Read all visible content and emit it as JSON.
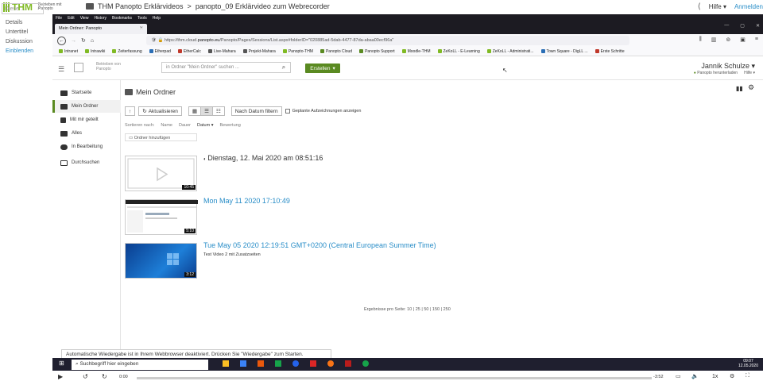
{
  "outer": {
    "logo": "THM",
    "logo_sub": "Betrieben mit Panopto",
    "breadcrumb_root": "THM Panopto Erklärvideos",
    "breadcrumb_sep": ">",
    "breadcrumb_current": "panopto_09 Erklärvideo zum Webrecorder",
    "help": "Hilfe",
    "login": "Anmelden",
    "search_placeholder": "Diese ...",
    "side_links": [
      "Details",
      "Untertitel",
      "Diskussion",
      "Einblenden"
    ]
  },
  "browser": {
    "menu": [
      "File",
      "Edit",
      "View",
      "History",
      "Bookmarks",
      "Tools",
      "Help"
    ],
    "tab_title": "Mein Ordner: Panopto",
    "url_prefix": "https://thm.cloud.",
    "url_domain": "panopto.eu",
    "url_rest": "/Panopto/Pages/Sessions/List.aspx#folderID=\"020885ad-5dab-4477-87da-abaa00ecf96a\"",
    "bookmarks": [
      {
        "label": "Intranet",
        "color": "#80ba24"
      },
      {
        "label": "Intrawiki",
        "color": "#80ba24"
      },
      {
        "label": "Zeiterfassung",
        "color": "#80ba24"
      },
      {
        "label": "Etherpad",
        "color": "#2a6eb5"
      },
      {
        "label": "EtherCalc",
        "color": "#c0392b"
      },
      {
        "label": "Live-Mahara",
        "color": "#555"
      },
      {
        "label": "Projekt-Mahara",
        "color": "#555"
      },
      {
        "label": "Panopto-THM",
        "color": "#80ba24"
      },
      {
        "label": "Panopto Cloud",
        "color": "#5a8a21"
      },
      {
        "label": "Panopto Support",
        "color": "#5a8a21"
      },
      {
        "label": "Moodle-THM",
        "color": "#80ba24"
      },
      {
        "label": "ZeKoLL - E-Learning",
        "color": "#80ba24"
      },
      {
        "label": "ZeKoLL - Administrati...",
        "color": "#80ba24"
      },
      {
        "label": "Town Square - DigLL ...",
        "color": "#2a6eb5"
      },
      {
        "label": "Erste Schritte",
        "color": "#c0392b"
      }
    ]
  },
  "panopto": {
    "logo_text": "Betrieben von Panopto",
    "search_placeholder": "in Ordner \"Mein Ordner\" suchen ...",
    "create": "Erstellen",
    "user_name": "Jannik Schulze",
    "download": "Panopto herunterladen",
    "help": "Hilfe",
    "nav": [
      "Startseite",
      "Mein Ordner",
      "Mit mir geteilt",
      "Alles",
      "In Bearbeitung",
      "Durchsuchen"
    ],
    "folder_title": "Mein Ordner",
    "refresh": "Aktualisieren",
    "filter_date": "Nach Datum filtern",
    "scheduled": "Geplante Aufzeichnungen anzeigen",
    "sort_label": "Sortieren nach:",
    "sort_options": [
      "Name",
      "Dauer",
      "Datum",
      "Bewertung"
    ],
    "add_folder": "Ordner hinzufügen",
    "sessions": [
      {
        "title": "Dienstag, 12. Mai 2020 am 08:51:16",
        "duration": "10:45",
        "subtitle": ""
      },
      {
        "title": "Mon May 11 2020 17:10:49",
        "duration": "5:10",
        "subtitle": ""
      },
      {
        "title": "Tue May 05 2020 12:19:51 GMT+0200 (Central European Summer Time)",
        "duration": "3:12",
        "subtitle": "Test Video 2 mit Zusatzseiten"
      }
    ],
    "results_label": "Ergebnisse pro Seite:",
    "results_options": "10 | 25 | 50 | 150 | 250",
    "autoplay_notice": "Automatische Wiedergabe ist in Ihrem Webbrowser deaktiviert. Drücken Sie \"Wiedergabe\" zum Starten."
  },
  "taskbar": {
    "search": "Suchbegriff hier eingeben",
    "time": "09:07",
    "date": "12.05.2020"
  },
  "player": {
    "elapsed": "0:00",
    "remaining": "-3:52",
    "speed": "1x"
  }
}
